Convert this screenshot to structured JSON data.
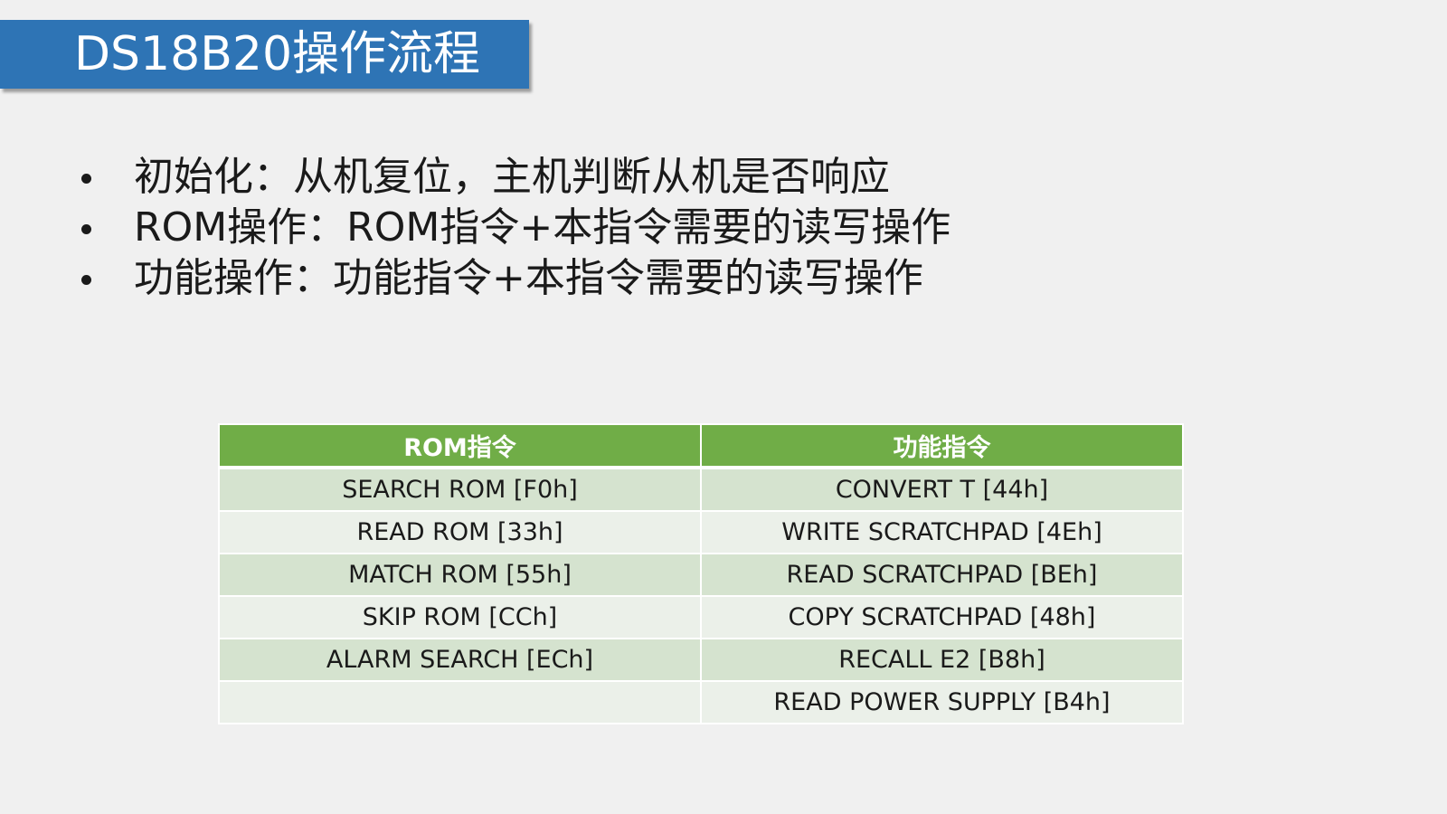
{
  "slide": {
    "title": "DS18B20操作流程"
  },
  "bullets": [
    "初始化：从机复位，主机判断从机是否响应",
    "ROM操作：ROM指令+本指令需要的读写操作",
    "功能操作：功能指令+本指令需要的读写操作"
  ],
  "table": {
    "headers": [
      "ROM指令",
      "功能指令"
    ],
    "rows": [
      [
        "SEARCH ROM [F0h]",
        "CONVERT T [44h]"
      ],
      [
        "READ ROM [33h]",
        "WRITE SCRATCHPAD [4Eh]"
      ],
      [
        "MATCH ROM [55h]",
        "READ SCRATCHPAD [BEh]"
      ],
      [
        "SKIP ROM [CCh]",
        "COPY SCRATCHPAD [48h]"
      ],
      [
        "ALARM SEARCH [ECh]",
        "RECALL E2 [B8h]"
      ],
      [
        "",
        "READ POWER SUPPLY [B4h]"
      ]
    ]
  },
  "colors": {
    "title_bar": "#2e74b5",
    "header_row": "#70ad47",
    "row_dark": "#d5e3cf",
    "row_light": "#ebf0e9"
  }
}
